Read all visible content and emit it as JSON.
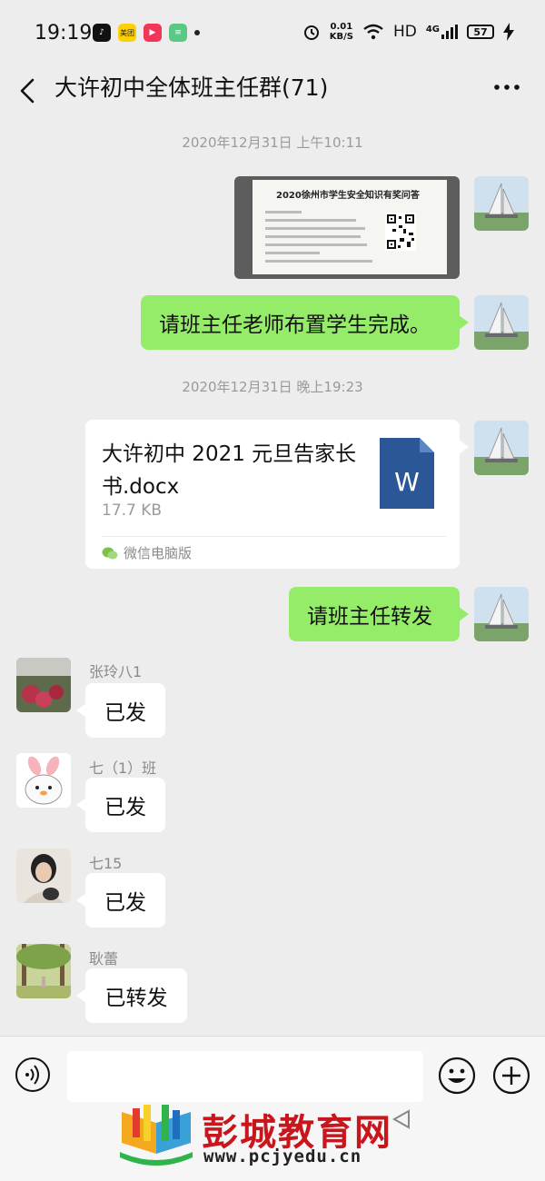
{
  "status_bar": {
    "time": "19:19",
    "app_meituan": "美团",
    "network_speed_value": "0.01",
    "network_speed_unit": "KB/S",
    "hd": "HD",
    "signal_label": "4G",
    "battery": "57"
  },
  "header": {
    "title": "大许初中全体班主任群(71)"
  },
  "messages": {
    "ts1": "2020年12月31日 上午10:11",
    "image_title": "2020徐州市学生安全知识有奖问答",
    "text1": "请班主任老师布置学生完成。",
    "ts2": "2020年12月31日 晚上19:23",
    "file_name": "大许初中 2021 元旦告家长书.docx",
    "file_size": "17.7 KB",
    "file_source": "微信电脑版",
    "file_icon_letter": "W",
    "text2": "请班主任转发",
    "r1_name": "张玲八1",
    "r1_text": "已发",
    "r2_name": "七（1）班",
    "r2_text": "已发",
    "r3_name": "七15",
    "r3_text": "已发",
    "r4_name": "耿蕾",
    "r4_text": "已转发"
  },
  "input_bar": {
    "placeholder": ""
  },
  "watermark": {
    "title": "彭城教育网",
    "url": "www.pcjyedu.cn"
  },
  "colors": {
    "bubble_green": "#95ec69",
    "background": "#ededed",
    "watermark_red": "#c8161d",
    "word_blue": "#2b5797"
  }
}
